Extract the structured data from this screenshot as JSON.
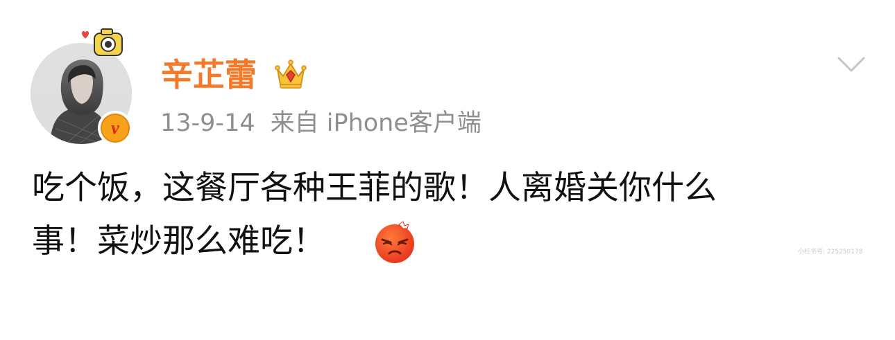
{
  "post": {
    "username": "辛芷蕾",
    "date": "13-9-14",
    "source": "来自 iPhone客户端",
    "text_line1": "吃个饭，这餐厅各种王菲的歌！人离婚关你什么",
    "text_line2": "事！菜炒那么难吃！",
    "emoji": "angry-face-icon",
    "verified_badge_letter": "v",
    "watermark": "小红书号: 225250178"
  },
  "colors": {
    "username": "#f47a2a",
    "meta": "#8f8f8f",
    "text": "#111111",
    "chevron": "#c4c4c4",
    "badge": "#f7a21b"
  }
}
